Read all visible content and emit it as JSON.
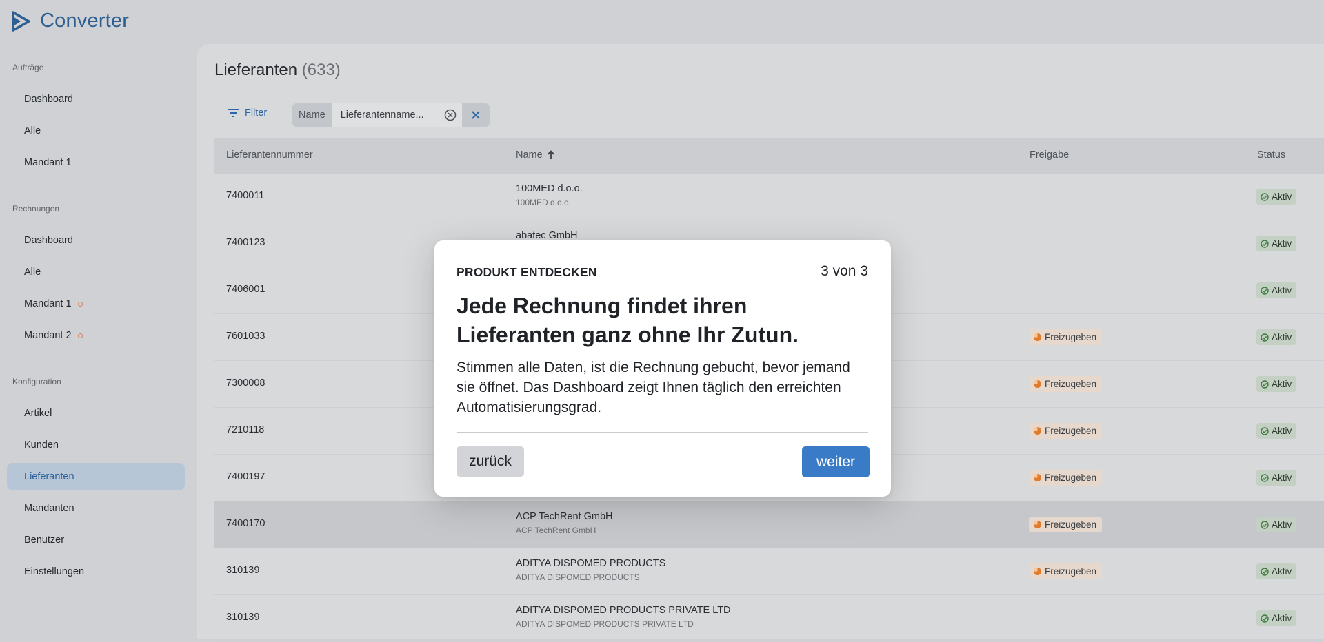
{
  "app": {
    "name": "Converter"
  },
  "sidebar": {
    "sections": [
      {
        "label": "Aufträge",
        "items": [
          {
            "label": "Dashboard"
          },
          {
            "label": "Alle"
          },
          {
            "label": "Mandant 1"
          }
        ]
      },
      {
        "label": "Rechnungen",
        "items": [
          {
            "label": "Dashboard"
          },
          {
            "label": "Alle"
          },
          {
            "label": "Mandant 1",
            "has_dot": true
          },
          {
            "label": "Mandant 2",
            "has_dot": true
          }
        ]
      },
      {
        "label": "Konfiguration",
        "items": [
          {
            "label": "Artikel"
          },
          {
            "label": "Kunden"
          },
          {
            "label": "Lieferanten",
            "active": true
          },
          {
            "label": "Mandanten"
          },
          {
            "label": "Benutzer"
          },
          {
            "label": "Einstellungen"
          }
        ]
      }
    ]
  },
  "main": {
    "title": "Lieferanten",
    "count": "(633)",
    "filter_label": "Filter",
    "chip": {
      "label": "Name",
      "value": "Lieferantenname..."
    },
    "table": {
      "columns": [
        "Lieferantennummer",
        "Name",
        "Freigabe",
        "Status"
      ],
      "rows": [
        {
          "number": "7400011",
          "name": "100MED d.o.o.",
          "sub": "100MED d.o.o.",
          "freigabe": "",
          "status": "Aktiv"
        },
        {
          "number": "7400123",
          "name": "abatec GmbH",
          "sub": "",
          "freigabe": "",
          "status": "Aktiv"
        },
        {
          "number": "7406001",
          "name": "",
          "sub": "",
          "freigabe": "",
          "status": "Aktiv"
        },
        {
          "number": "7601033",
          "name": "",
          "sub": "",
          "freigabe": "Freizugeben",
          "status": "Aktiv"
        },
        {
          "number": "7300008",
          "name": "",
          "sub": "",
          "freigabe": "Freizugeben",
          "status": "Aktiv"
        },
        {
          "number": "7210118",
          "name": "",
          "sub": "",
          "freigabe": "Freizugeben",
          "status": "Aktiv"
        },
        {
          "number": "7400197",
          "name": "",
          "sub": "",
          "freigabe": "Freizugeben",
          "status": "Aktiv"
        },
        {
          "number": "7400170",
          "name": "ACP TechRent GmbH",
          "sub": "ACP TechRent GmbH",
          "freigabe": "Freizugeben",
          "status": "Aktiv",
          "highlighted": true
        },
        {
          "number": "310139",
          "name": "ADITYA DISPOMED PRODUCTS",
          "sub": "ADITYA DISPOMED PRODUCTS",
          "freigabe": "Freizugeben",
          "status": "Aktiv"
        },
        {
          "number": "310139",
          "name": "ADITYA DISPOMED PRODUCTS PRIVATE LTD",
          "sub": "ADITYA DISPOMED PRODUCTS PRIVATE LTD",
          "freigabe": "",
          "status": "Aktiv"
        }
      ]
    }
  },
  "modal": {
    "kicker": "PRODUKT ENTDECKEN",
    "step": "3 von 3",
    "title": "Jede Rechnung findet ihren Lieferanten ganz ohne Ihr Zutun.",
    "body": "Stimmen alle Daten, ist die Rechnung gebucht, bevor jemand sie öffnet. Das Dashboard zeigt Ihnen täglich den erreichten Automatisierungsgrad.",
    "back_label": "zurück",
    "next_label": "weiter"
  },
  "colors": {
    "accent": "#3a7bc8",
    "brand": "#2e5f93",
    "pending": "#e07b2b",
    "active": "#3b7a3b"
  }
}
